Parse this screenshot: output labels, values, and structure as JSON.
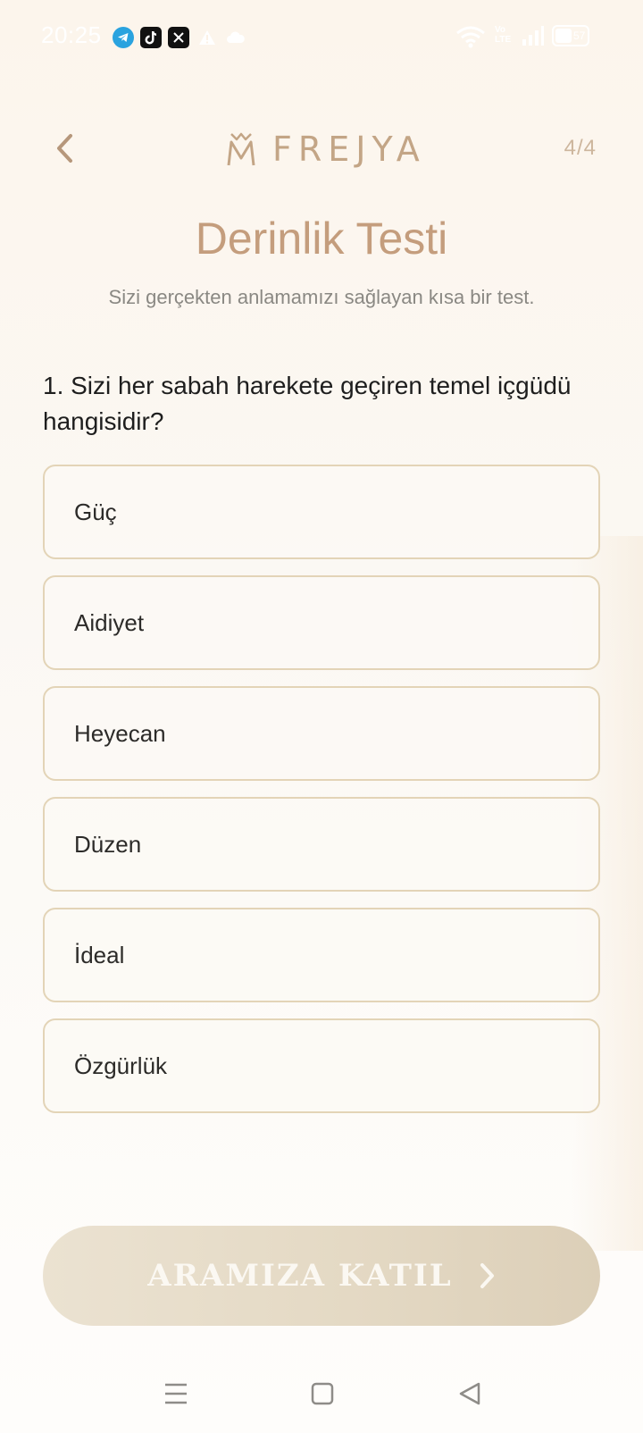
{
  "status_bar": {
    "time": "20:25",
    "apps": [
      "telegram-icon",
      "tiktok-icon",
      "x-icon",
      "alert-icon",
      "cloud-icon"
    ],
    "network": "Vo LTE",
    "battery": "57"
  },
  "header": {
    "brand": "FREJYA",
    "step": "4/4"
  },
  "title": "Derinlik Testi",
  "subtitle": "Sizi gerçekten anlamamızı sağlayan kısa bir test.",
  "question": "1. Sizi her sabah harekete geçiren temel içgüdü hangisidir?",
  "options": [
    {
      "label": "Güç"
    },
    {
      "label": "Aidiyet"
    },
    {
      "label": "Heyecan"
    },
    {
      "label": "Düzen"
    },
    {
      "label": "İdeal"
    },
    {
      "label": "Özgürlük"
    }
  ],
  "cta": {
    "label": "ARAMIZA KATIL"
  },
  "colors": {
    "accent": "#c49d7d",
    "option_border": "#e3d4b7",
    "cta_background": "#e4d9c4"
  }
}
